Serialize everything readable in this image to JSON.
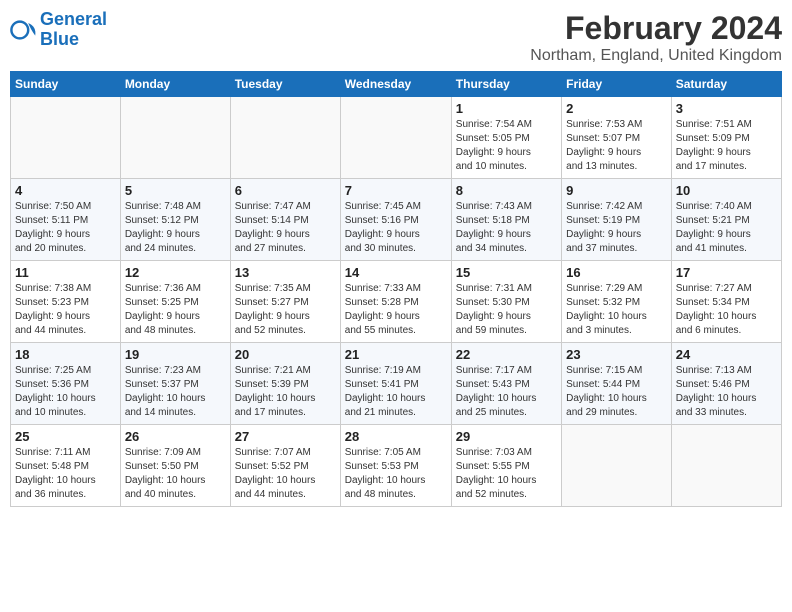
{
  "logo": {
    "line1": "General",
    "line2": "Blue"
  },
  "title": "February 2024",
  "subtitle": "Northam, England, United Kingdom",
  "days_of_week": [
    "Sunday",
    "Monday",
    "Tuesday",
    "Wednesday",
    "Thursday",
    "Friday",
    "Saturday"
  ],
  "weeks": [
    [
      {
        "num": "",
        "info": ""
      },
      {
        "num": "",
        "info": ""
      },
      {
        "num": "",
        "info": ""
      },
      {
        "num": "",
        "info": ""
      },
      {
        "num": "1",
        "info": "Sunrise: 7:54 AM\nSunset: 5:05 PM\nDaylight: 9 hours\nand 10 minutes."
      },
      {
        "num": "2",
        "info": "Sunrise: 7:53 AM\nSunset: 5:07 PM\nDaylight: 9 hours\nand 13 minutes."
      },
      {
        "num": "3",
        "info": "Sunrise: 7:51 AM\nSunset: 5:09 PM\nDaylight: 9 hours\nand 17 minutes."
      }
    ],
    [
      {
        "num": "4",
        "info": "Sunrise: 7:50 AM\nSunset: 5:11 PM\nDaylight: 9 hours\nand 20 minutes."
      },
      {
        "num": "5",
        "info": "Sunrise: 7:48 AM\nSunset: 5:12 PM\nDaylight: 9 hours\nand 24 minutes."
      },
      {
        "num": "6",
        "info": "Sunrise: 7:47 AM\nSunset: 5:14 PM\nDaylight: 9 hours\nand 27 minutes."
      },
      {
        "num": "7",
        "info": "Sunrise: 7:45 AM\nSunset: 5:16 PM\nDaylight: 9 hours\nand 30 minutes."
      },
      {
        "num": "8",
        "info": "Sunrise: 7:43 AM\nSunset: 5:18 PM\nDaylight: 9 hours\nand 34 minutes."
      },
      {
        "num": "9",
        "info": "Sunrise: 7:42 AM\nSunset: 5:19 PM\nDaylight: 9 hours\nand 37 minutes."
      },
      {
        "num": "10",
        "info": "Sunrise: 7:40 AM\nSunset: 5:21 PM\nDaylight: 9 hours\nand 41 minutes."
      }
    ],
    [
      {
        "num": "11",
        "info": "Sunrise: 7:38 AM\nSunset: 5:23 PM\nDaylight: 9 hours\nand 44 minutes."
      },
      {
        "num": "12",
        "info": "Sunrise: 7:36 AM\nSunset: 5:25 PM\nDaylight: 9 hours\nand 48 minutes."
      },
      {
        "num": "13",
        "info": "Sunrise: 7:35 AM\nSunset: 5:27 PM\nDaylight: 9 hours\nand 52 minutes."
      },
      {
        "num": "14",
        "info": "Sunrise: 7:33 AM\nSunset: 5:28 PM\nDaylight: 9 hours\nand 55 minutes."
      },
      {
        "num": "15",
        "info": "Sunrise: 7:31 AM\nSunset: 5:30 PM\nDaylight: 9 hours\nand 59 minutes."
      },
      {
        "num": "16",
        "info": "Sunrise: 7:29 AM\nSunset: 5:32 PM\nDaylight: 10 hours\nand 3 minutes."
      },
      {
        "num": "17",
        "info": "Sunrise: 7:27 AM\nSunset: 5:34 PM\nDaylight: 10 hours\nand 6 minutes."
      }
    ],
    [
      {
        "num": "18",
        "info": "Sunrise: 7:25 AM\nSunset: 5:36 PM\nDaylight: 10 hours\nand 10 minutes."
      },
      {
        "num": "19",
        "info": "Sunrise: 7:23 AM\nSunset: 5:37 PM\nDaylight: 10 hours\nand 14 minutes."
      },
      {
        "num": "20",
        "info": "Sunrise: 7:21 AM\nSunset: 5:39 PM\nDaylight: 10 hours\nand 17 minutes."
      },
      {
        "num": "21",
        "info": "Sunrise: 7:19 AM\nSunset: 5:41 PM\nDaylight: 10 hours\nand 21 minutes."
      },
      {
        "num": "22",
        "info": "Sunrise: 7:17 AM\nSunset: 5:43 PM\nDaylight: 10 hours\nand 25 minutes."
      },
      {
        "num": "23",
        "info": "Sunrise: 7:15 AM\nSunset: 5:44 PM\nDaylight: 10 hours\nand 29 minutes."
      },
      {
        "num": "24",
        "info": "Sunrise: 7:13 AM\nSunset: 5:46 PM\nDaylight: 10 hours\nand 33 minutes."
      }
    ],
    [
      {
        "num": "25",
        "info": "Sunrise: 7:11 AM\nSunset: 5:48 PM\nDaylight: 10 hours\nand 36 minutes."
      },
      {
        "num": "26",
        "info": "Sunrise: 7:09 AM\nSunset: 5:50 PM\nDaylight: 10 hours\nand 40 minutes."
      },
      {
        "num": "27",
        "info": "Sunrise: 7:07 AM\nSunset: 5:52 PM\nDaylight: 10 hours\nand 44 minutes."
      },
      {
        "num": "28",
        "info": "Sunrise: 7:05 AM\nSunset: 5:53 PM\nDaylight: 10 hours\nand 48 minutes."
      },
      {
        "num": "29",
        "info": "Sunrise: 7:03 AM\nSunset: 5:55 PM\nDaylight: 10 hours\nand 52 minutes."
      },
      {
        "num": "",
        "info": ""
      },
      {
        "num": "",
        "info": ""
      }
    ]
  ]
}
